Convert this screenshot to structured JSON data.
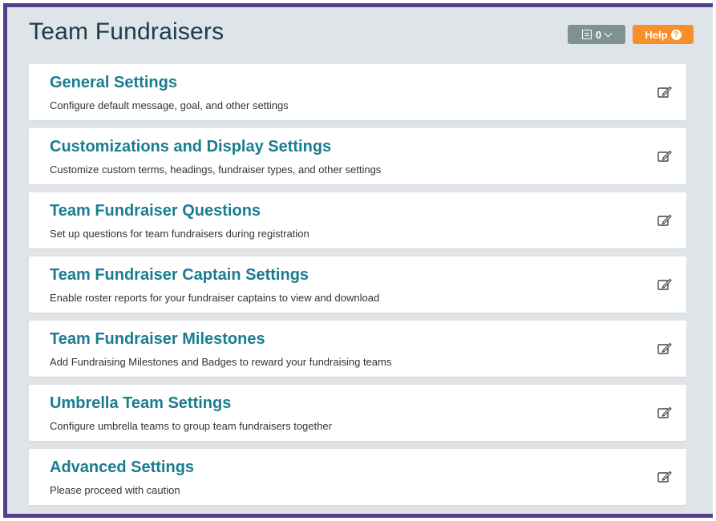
{
  "header": {
    "title": "Team Fundraisers",
    "notes_count": "0",
    "help_label": "Help"
  },
  "icons": {
    "notes": "notes-icon",
    "dropdown": "chevron-down-icon",
    "help": "question-circle-icon",
    "edit": "edit-icon"
  },
  "colors": {
    "frame_border": "#54408a",
    "background": "#dfe4e8",
    "title": "#1d3c4e",
    "card_title": "#1a7c91",
    "notes_button": "#7f9190",
    "help_button": "#f7902b"
  },
  "settings": [
    {
      "id": "general",
      "title": "General Settings",
      "description": "Configure default message, goal, and other settings"
    },
    {
      "id": "customizations",
      "title": "Customizations and Display Settings",
      "description": "Customize custom terms, headings, fundraiser types, and other settings"
    },
    {
      "id": "questions",
      "title": "Team Fundraiser Questions",
      "description": "Set up questions for team fundraisers during registration"
    },
    {
      "id": "captain",
      "title": "Team Fundraiser Captain Settings",
      "description": "Enable roster reports for your fundraiser captains to view and download"
    },
    {
      "id": "milestones",
      "title": "Team Fundraiser Milestones",
      "description": "Add Fundraising Milestones and Badges to reward your fundraising teams"
    },
    {
      "id": "umbrella",
      "title": "Umbrella Team Settings",
      "description": "Configure umbrella teams to group team fundraisers together"
    },
    {
      "id": "advanced",
      "title": "Advanced Settings",
      "description": "Please proceed with caution"
    }
  ]
}
